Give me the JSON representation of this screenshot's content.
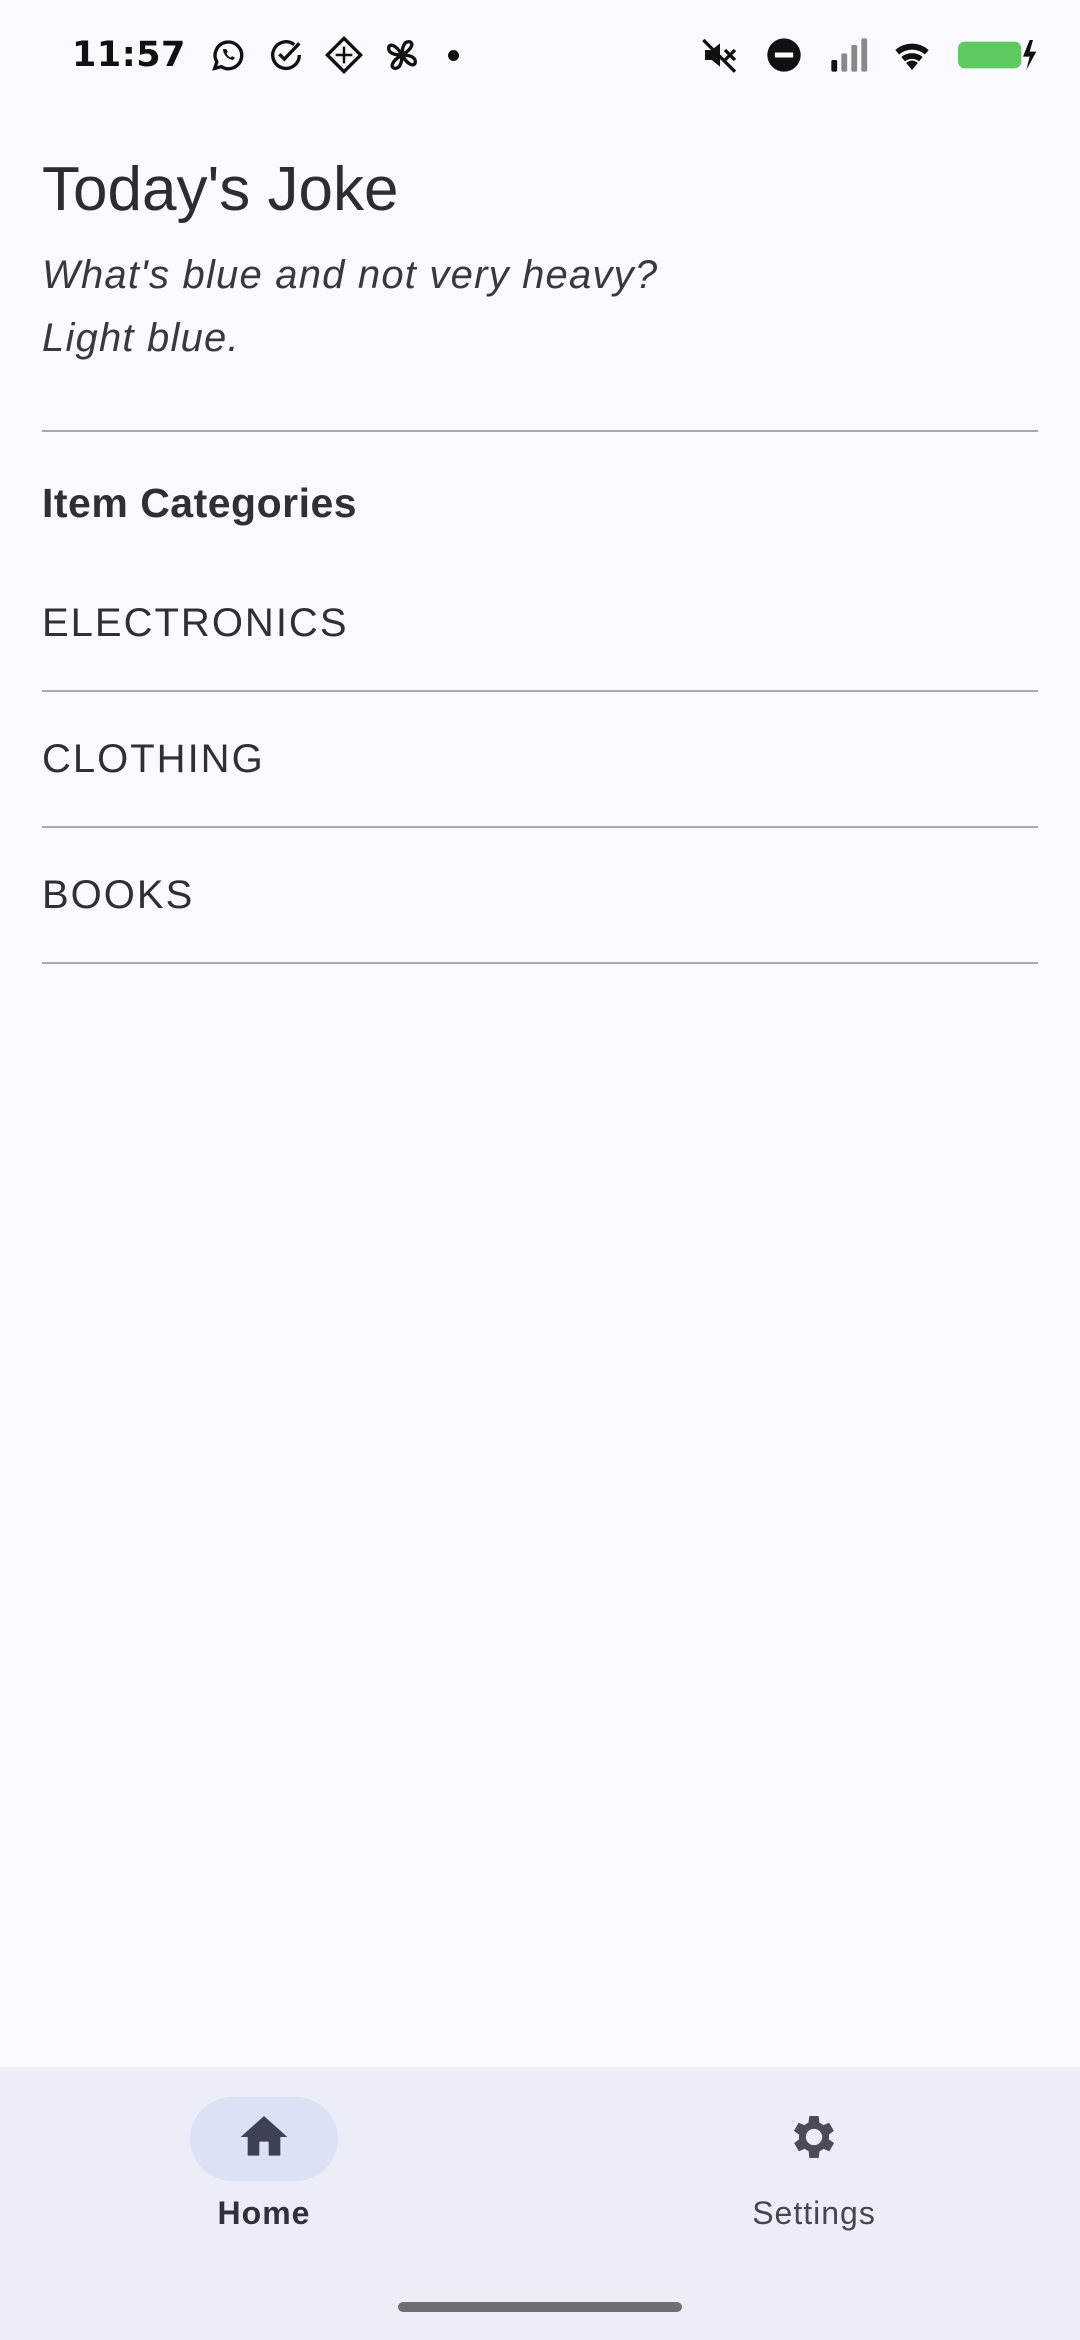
{
  "status_bar": {
    "time": "11:57",
    "icons_left": [
      "whatsapp-icon",
      "check-circle-icon",
      "app-diamond-icon",
      "pinwheel-icon",
      "dot-icon"
    ],
    "icons_right": [
      "mute-icon",
      "do-not-disturb-icon",
      "signal-icon",
      "wifi-icon",
      "battery-charging-icon"
    ],
    "battery_color": "#5ec95e"
  },
  "joke": {
    "title": "Today's Joke",
    "line1": "What's blue and not very heavy?",
    "line2": "Light blue."
  },
  "categories": {
    "heading": "Item Categories",
    "items": [
      {
        "label": "ELECTRONICS"
      },
      {
        "label": "CLOTHING"
      },
      {
        "label": "BOOKS"
      }
    ]
  },
  "bottom_nav": {
    "items": [
      {
        "label": "Home",
        "icon": "home-icon",
        "selected": true
      },
      {
        "label": "Settings",
        "icon": "gear-icon",
        "selected": false
      }
    ],
    "accent": "#dce1f6"
  }
}
